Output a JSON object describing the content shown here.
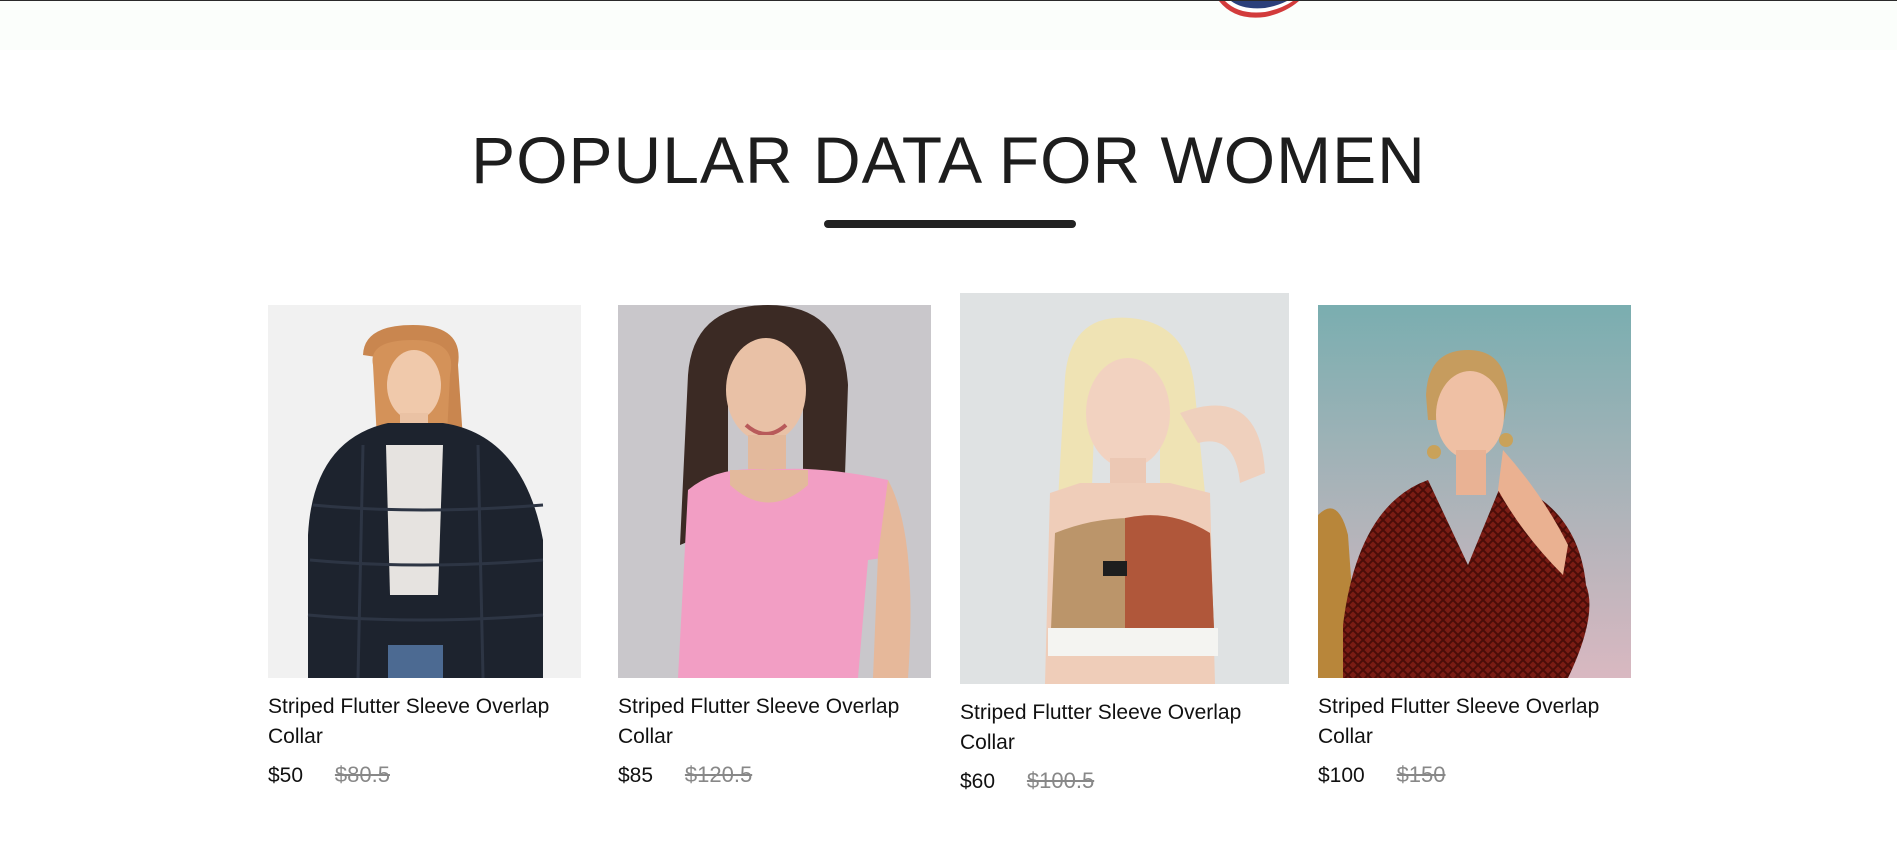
{
  "section": {
    "title": "POPULAR DATA FOR WOMEN"
  },
  "products": [
    {
      "name": "Striped Flutter Sleeve Overlap Collar",
      "price": "$50",
      "old_price": "$80.5",
      "image_icon": "model-black-fur-jacket-photo"
    },
    {
      "name": "Striped Flutter Sleeve Overlap Collar",
      "price": "$85",
      "old_price": "$120.5",
      "image_icon": "model-pink-top-photo"
    },
    {
      "name": "Striped Flutter Sleeve Overlap Collar",
      "price": "$60",
      "old_price": "$100.5",
      "image_icon": "model-sports-crop-top-photo"
    },
    {
      "name": "Striped Flutter Sleeve Overlap Collar",
      "price": "$100",
      "old_price": "$150",
      "image_icon": "model-red-wrap-dress-photo"
    }
  ],
  "colors": {
    "title": "#1d1d1d",
    "underline": "#222222",
    "price": "#111111",
    "old_price": "#888888"
  }
}
